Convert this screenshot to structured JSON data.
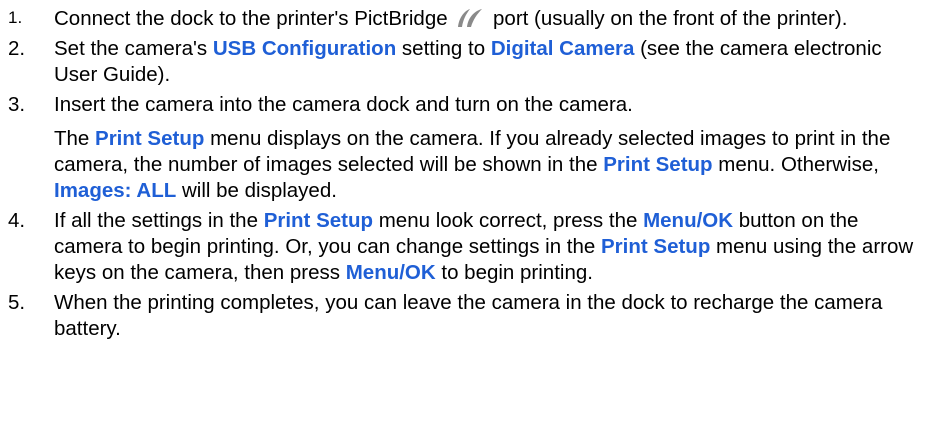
{
  "steps": [
    {
      "num": "1.",
      "t1": "Connect the dock to the printer's PictBridge ",
      "icon": "pictbridge-icon",
      "t2": " port (usually on the front of the printer)."
    },
    {
      "num": "2.",
      "t1": "Set the camera's ",
      "h1": "USB Configuration",
      "t2": " setting to ",
      "h2": "Digital Camera",
      "t3": " (see the camera electronic User Guide)."
    },
    {
      "num": "3.",
      "t1": "Insert the camera into the camera dock and turn on the camera.",
      "p_t1": "The ",
      "p_h1": "Print Setup",
      "p_t2": " menu displays on the camera. If you already selected images to print in the camera, the number of images selected will be shown in the ",
      "p_h2": "Print Setup",
      "p_t3": " menu. Otherwise, ",
      "p_h3": "Images: ALL",
      "p_t4": " will be displayed."
    },
    {
      "num": "4.",
      "t1": "If all the settings in the ",
      "h1": "Print Setup",
      "t2": " menu look correct, press the ",
      "h2": "Menu/OK",
      "t3": " button on the camera to begin printing. Or, you can change settings in the ",
      "h3": "Print Setup",
      "t4": " menu using the arrow keys on the camera, then press ",
      "h4": "Menu/OK",
      "t5": " to begin printing."
    },
    {
      "num": "5.",
      "t1": "When the printing completes, you can leave the camera in the dock to recharge the camera battery."
    }
  ],
  "colors": {
    "highlight": "#1f5fd6",
    "icon": "#8a8a8a"
  }
}
